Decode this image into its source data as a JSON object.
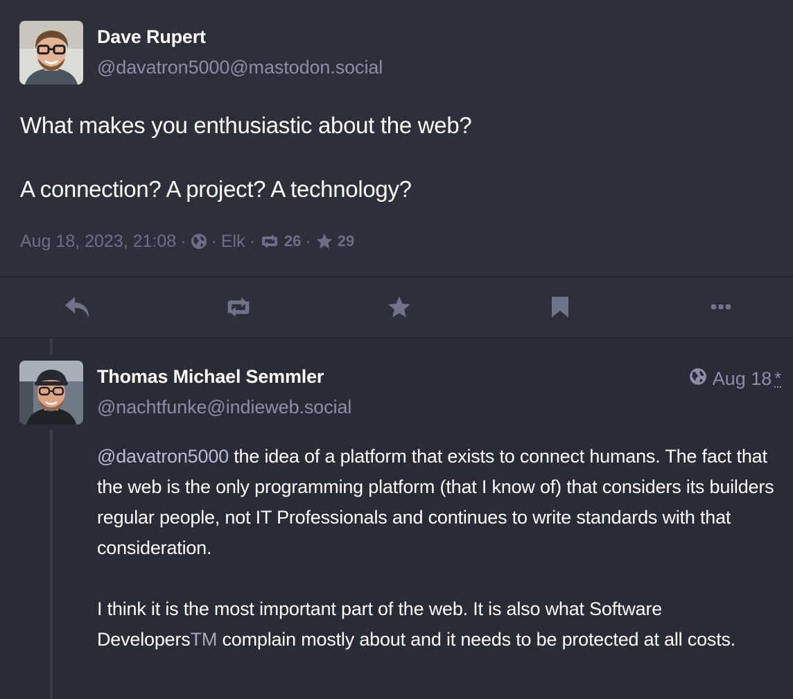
{
  "main_post": {
    "author": {
      "display_name": "Dave Rupert",
      "handle": "@davatron5000@mastodon.social"
    },
    "content": {
      "line1": "What makes you enthusiastic about the web?",
      "line2": "A connection? A project? A technology?"
    },
    "meta": {
      "timestamp": "Aug 18, 2023, 21:08",
      "separator": "·",
      "visibility_icon": "globe-icon",
      "client": "Elk",
      "boosts": "26",
      "favourites": "29"
    }
  },
  "actions": [
    {
      "name": "reply",
      "icon": "reply-icon"
    },
    {
      "name": "boost",
      "icon": "boost-icon"
    },
    {
      "name": "favourite",
      "icon": "star-icon"
    },
    {
      "name": "bookmark",
      "icon": "bookmark-icon"
    },
    {
      "name": "more",
      "icon": "more-icon"
    }
  ],
  "reply": {
    "author": {
      "display_name": "Thomas Michael Semmler",
      "handle": "@nachtfunke@indieweb.social"
    },
    "time": "Aug 18",
    "edited_marker": "*",
    "paragraph1": {
      "mention": "@davatron5000",
      "text": " the idea of a platform that exists to connect humans. The fact that the web is the only programming platform (that I know of) that considers its builders regular people, not IT Professionals and continues to write standards with that consideration."
    },
    "paragraph2": {
      "text_before": "I think it is the most important part of the web. It is also what Software Developers",
      "tm": "TM",
      "text_after": " complain mostly about and it needs to be protected at all costs."
    }
  },
  "colors": {
    "background": "#292b36",
    "main_post_background": "#2d2f3b",
    "muted_text": "#8c8ea8",
    "meta_text": "#6c6e87",
    "icon": "#6f7387"
  }
}
